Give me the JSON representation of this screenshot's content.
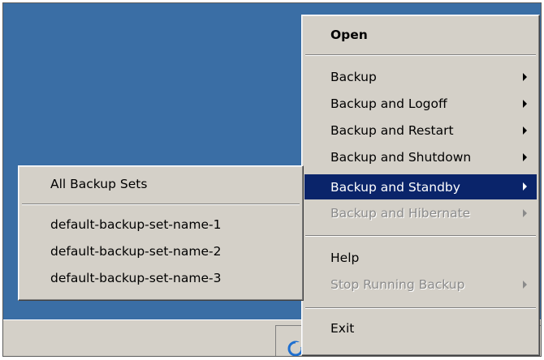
{
  "context_menu": {
    "items": [
      {
        "label": "Open",
        "bold": true
      },
      {
        "label": "Backup"
      },
      {
        "label": "Backup and Logoff"
      },
      {
        "label": "Backup and Restart"
      },
      {
        "label": "Backup and Shutdown"
      },
      {
        "label": "Backup and Standby",
        "selected": true
      },
      {
        "label": "Backup and Hibernate",
        "disabled": true
      },
      {
        "label": "Help"
      },
      {
        "label": "Stop Running Backup",
        "disabled": true
      },
      {
        "label": "Exit"
      }
    ]
  },
  "submenu": {
    "items": [
      {
        "label": "All Backup Sets"
      },
      {
        "label": "default-backup-set-name-1"
      },
      {
        "label": "default-backup-set-name-2"
      },
      {
        "label": "default-backup-set-name-3"
      }
    ]
  },
  "tray": {
    "icons": [
      "backup-app-icon",
      "shield-icon",
      "folder-icon",
      "keyboard-icon",
      "network-error-icon",
      "monitor-icon"
    ]
  },
  "colors": {
    "desktop": "#3a6ea5",
    "menu_bg": "#d4d0c8",
    "selection": "#0a246a"
  }
}
